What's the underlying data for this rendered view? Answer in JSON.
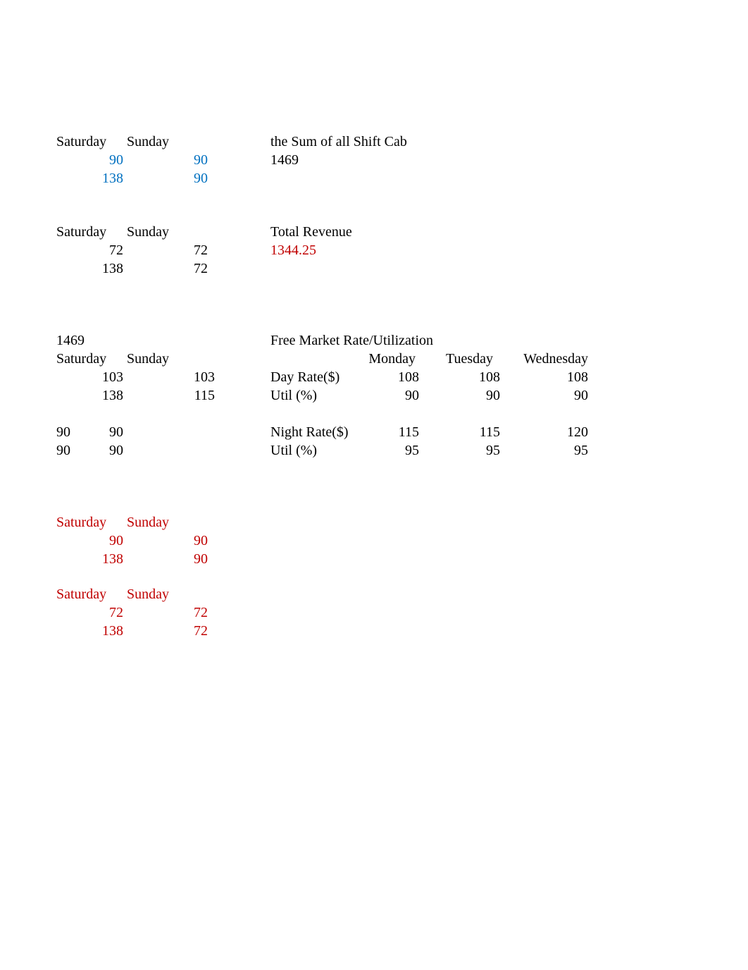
{
  "block1": {
    "sat_header": "Saturday",
    "sun_header": "Sunday",
    "r1c1": "90",
    "r1c2": "90",
    "r2c1": "138",
    "r2c2": "90",
    "sum_label": "the Sum of all Shift Cab",
    "sum_value": "1469"
  },
  "block2": {
    "sat_header": "Saturday",
    "sun_header": "Sunday",
    "r1c1": "72",
    "r1c2": "72",
    "r2c1": "138",
    "r2c2": "72",
    "rev_label": "Total Revenue",
    "rev_value": "1344.25"
  },
  "block3": {
    "top_left": "1469",
    "sat_header": "Saturday",
    "sun_header": "Sunday",
    "r1c1": "103",
    "r1c2": "103",
    "r2c1": "138",
    "r2c2": "115",
    "r3c1": "90",
    "r3c2": "90",
    "r4c1": "90",
    "r4c2": "90"
  },
  "market": {
    "title": "Free Market Rate/Utilization",
    "days": {
      "mon": "Monday",
      "tue": "Tuesday",
      "wed": "Wednesday"
    },
    "dayrate_label": "Day Rate($)",
    "util_label1": "Util (%)",
    "nightrate_label": "Night Rate($)",
    "util_label2": "Util (%)",
    "dayrate": {
      "mon": "108",
      "tue": "108",
      "wed": "108"
    },
    "util1": {
      "mon": "90",
      "tue": "90",
      "wed": "90"
    },
    "nightrate": {
      "mon": "115",
      "tue": "115",
      "wed": "120"
    },
    "util2": {
      "mon": "95",
      "tue": "95",
      "wed": "95"
    }
  },
  "block4": {
    "sat_header": "Saturday",
    "sun_header": "Sunday",
    "r1c1": "90",
    "r1c2": "90",
    "r2c1": "138",
    "r2c2": "90"
  },
  "block5": {
    "sat_header": "Saturday",
    "sun_header": "Sunday",
    "r1c1": "72",
    "r1c2": "72",
    "r2c1": "138",
    "r2c2": "72"
  }
}
